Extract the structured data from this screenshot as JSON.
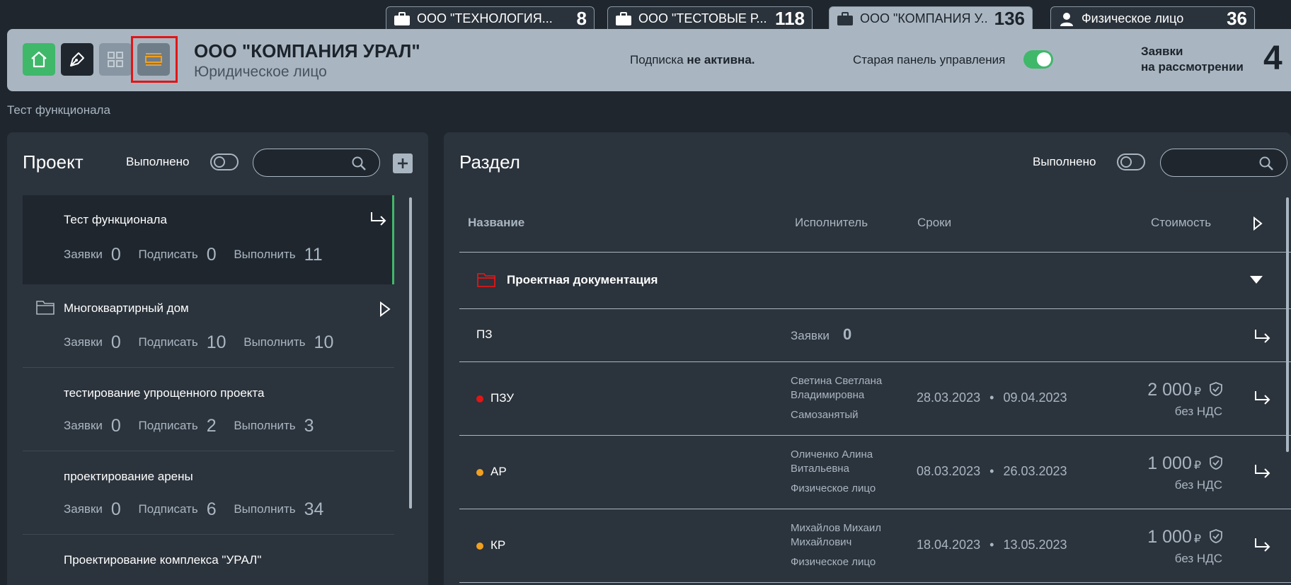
{
  "tabs": [
    {
      "name": "ООО \"ТЕХНОЛОГИЯ...",
      "count": "8",
      "icon": "briefcase-icon"
    },
    {
      "name": "ООО \"ТЕСТОВЫЕ Р...",
      "count": "118",
      "icon": "briefcase-icon"
    },
    {
      "name": "ООО \"КОМПАНИЯ У...",
      "count": "136",
      "icon": "briefcase-icon"
    },
    {
      "name": "Физическое лицо",
      "count": "36",
      "icon": "person-icon"
    }
  ],
  "header": {
    "title": "ООО \"КОМПАНИЯ УРАЛ\"",
    "subtitle": "Юридическое лицо",
    "subscription_prefix": "Подписка",
    "subscription_status": "не активна.",
    "old_panel_label": "Старая панель управления",
    "pending_line1": "Заявки",
    "pending_line2": "на рассмотрении",
    "pending_count": "4",
    "accent_green": "#3fb86a",
    "selection_color": "#e01616"
  },
  "breadcrumb": "Тест функционала",
  "left": {
    "title": "Проект",
    "done_label": "Выполнено",
    "stat_labels": {
      "requests": "Заявки",
      "sign": "Подписать",
      "execute": "Выполнить"
    },
    "projects": [
      {
        "name": "Тест функционала",
        "requests": "0",
        "sign": "0",
        "execute": "11"
      },
      {
        "name": "Многоквартирный дом",
        "requests": "0",
        "sign": "10",
        "execute": "10"
      },
      {
        "name": "тестирование упрощенного проекта",
        "requests": "0",
        "sign": "2",
        "execute": "3"
      },
      {
        "name": "проектирование арены",
        "requests": "0",
        "sign": "6",
        "execute": "34"
      },
      {
        "name": "Проектирование комплекса \"УРАЛ\""
      }
    ]
  },
  "right": {
    "title": "Раздел",
    "done_label": "Выполнено",
    "columns": {
      "name": "Название",
      "executor": "Исполнитель",
      "terms": "Сроки",
      "cost": "Стоимость"
    },
    "group": "Проектная документация",
    "pz": {
      "name": "ПЗ",
      "requests_label": "Заявки",
      "requests": "0"
    },
    "rows": [
      {
        "name": "ПЗУ",
        "dot": "#e01616",
        "executor_line1": "Светина Светлана",
        "executor_line2": "Владимировна",
        "executor_type": "Самозанятый",
        "start": "28.03.2023",
        "end": "09.04.2023",
        "price": "2 000",
        "currency": "₽",
        "vat": "без НДС"
      },
      {
        "name": "АР",
        "dot": "#f0a020",
        "executor_line1": "Оличенко Алина",
        "executor_line2": "Витальевна",
        "executor_type": "Физическое лицо",
        "start": "08.03.2023",
        "end": "26.03.2023",
        "price": "1 000",
        "currency": "₽",
        "vat": "без НДС"
      },
      {
        "name": "КР",
        "dot": "#f0a020",
        "executor_line1": "Михайлов Михаил",
        "executor_line2": "Михайлович",
        "executor_type": "Физическое лицо",
        "start": "18.04.2023",
        "end": "13.05.2023",
        "price": "1 000",
        "currency": "₽",
        "vat": "без НДС"
      }
    ],
    "date_sep": "•"
  }
}
